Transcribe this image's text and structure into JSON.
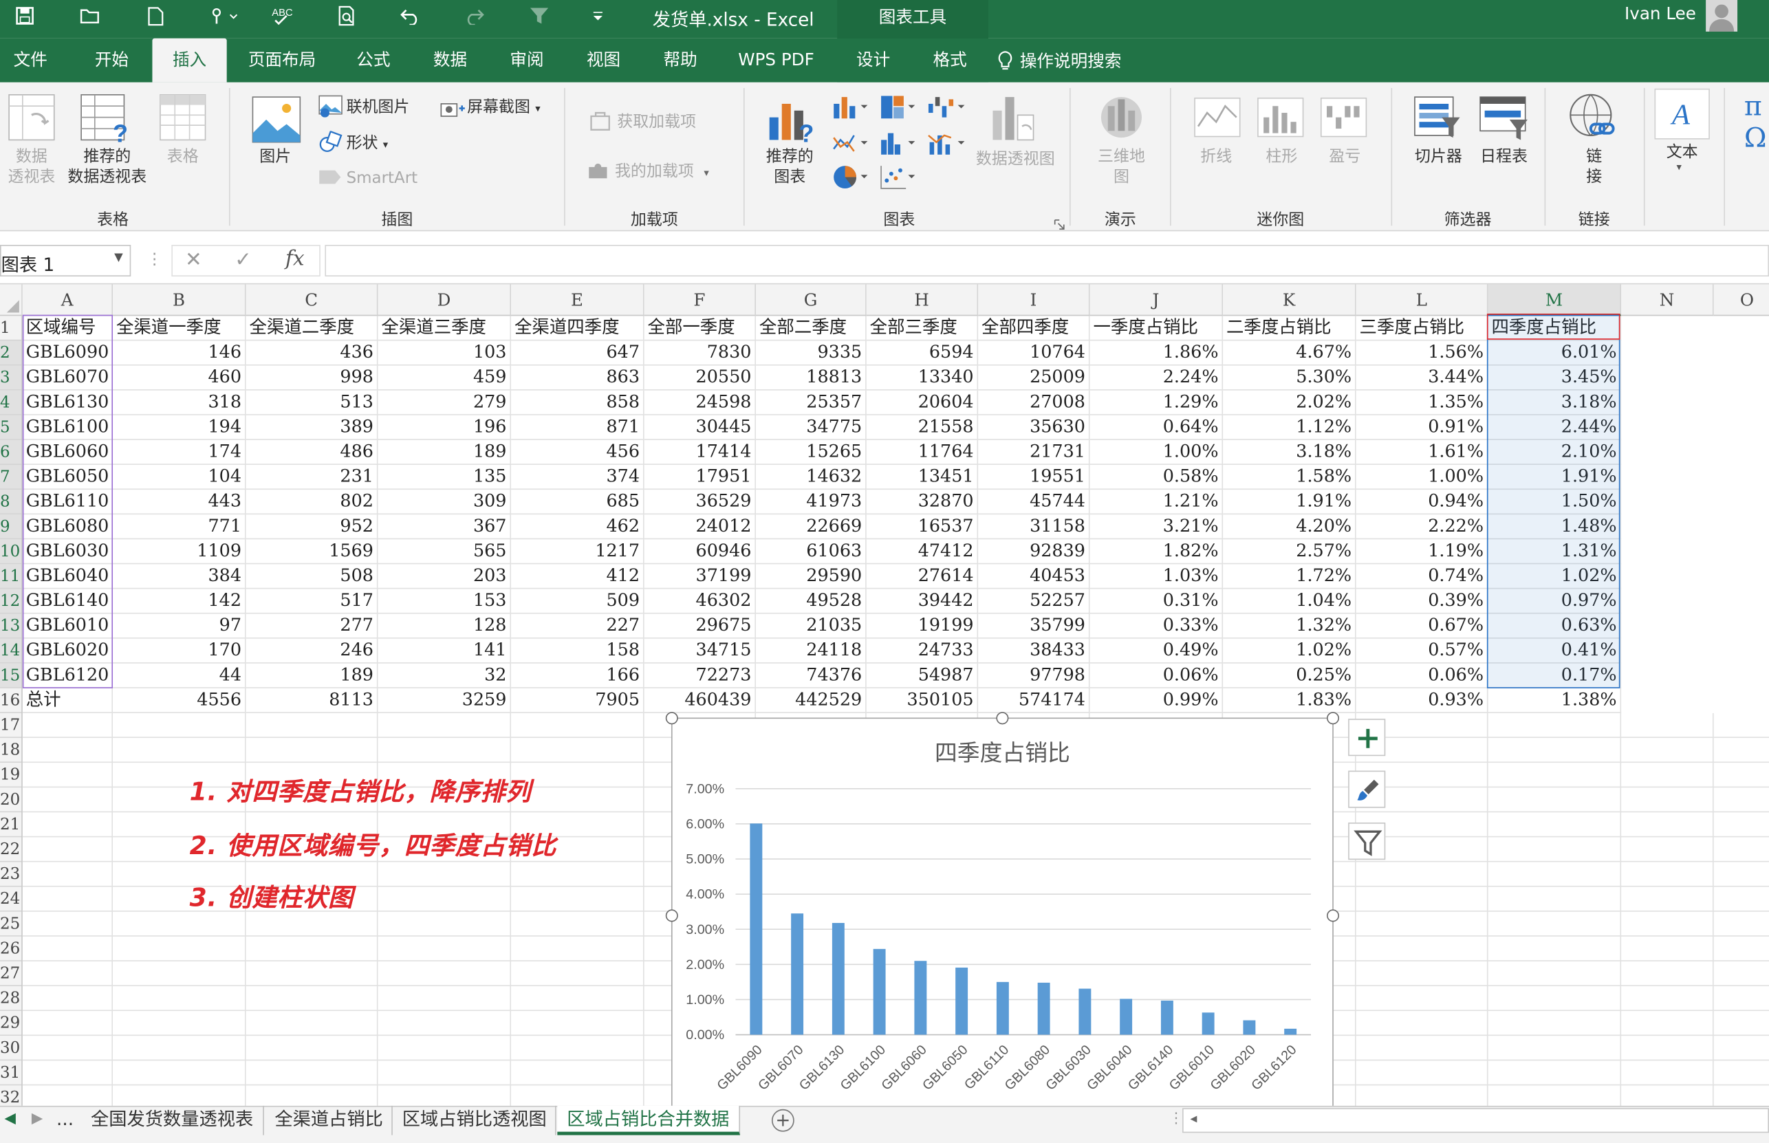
{
  "window": {
    "title": "发货单.xlsx  -  Excel",
    "context_tools": "图表工具",
    "user": "Ivan Lee",
    "accent": "#217346"
  },
  "qat_icons": [
    "save-icon",
    "open-icon",
    "new-icon",
    "touch-mode-icon",
    "spellcheck-icon",
    "print-preview-icon",
    "undo-icon",
    "redo-icon",
    "filter-icon",
    "customize-icon"
  ],
  "tabs": [
    "文件",
    "开始",
    "插入",
    "页面布局",
    "公式",
    "数据",
    "审阅",
    "视图",
    "帮助",
    "WPS PDF",
    "设计",
    "格式"
  ],
  "active_tab": "插入",
  "tell_me": "操作说明搜索",
  "ribbon": {
    "tables": {
      "group": "表格",
      "pivot": "数据\n透视表",
      "recommended_pivot": "推荐的\n数据透视表",
      "table": "表格"
    },
    "illustrations": {
      "group": "插图",
      "pictures": "图片",
      "online_pictures": "联机图片",
      "shapes": "形状",
      "smartart": "SmartArt",
      "screenshot": "屏幕截图"
    },
    "addins": {
      "group": "加载项",
      "get": "获取加载项",
      "my": "我的加载项"
    },
    "charts": {
      "group": "图表",
      "recommended": "推荐的\n图表",
      "pivot_chart": "数据透视图"
    },
    "tours": {
      "group": "演示",
      "map3d": "三维地\n图"
    },
    "sparklines": {
      "group": "迷你图",
      "line": "折线",
      "column": "柱形",
      "winloss": "盈亏"
    },
    "filters": {
      "group": "筛选器",
      "slicer": "切片器",
      "timeline": "日程表"
    },
    "links": {
      "group": "链接",
      "link": "链\n接"
    },
    "text": {
      "label": "文本"
    }
  },
  "formula_bar": {
    "name_box": "图表 1",
    "fx": "fx",
    "formula": ""
  },
  "columns": [
    "A",
    "B",
    "C",
    "D",
    "E",
    "F",
    "G",
    "H",
    "I",
    "J",
    "K",
    "L",
    "M",
    "N",
    "O"
  ],
  "rows": [
    [
      "区域编号",
      "全渠道一季度",
      "全渠道二季度",
      "全渠道三季度",
      "全渠道四季度",
      "全部一季度",
      "全部二季度",
      "全部三季度",
      "全部四季度",
      "一季度占销比",
      "二季度占销比",
      "三季度占销比",
      "四季度占销比"
    ],
    [
      "GBL6090",
      "146",
      "436",
      "103",
      "647",
      "7830",
      "9335",
      "6594",
      "10764",
      "1.86%",
      "4.67%",
      "1.56%",
      "6.01%"
    ],
    [
      "GBL6070",
      "460",
      "998",
      "459",
      "863",
      "20550",
      "18813",
      "13340",
      "25009",
      "2.24%",
      "5.30%",
      "3.44%",
      "3.45%"
    ],
    [
      "GBL6130",
      "318",
      "513",
      "279",
      "858",
      "24598",
      "25357",
      "20604",
      "27008",
      "1.29%",
      "2.02%",
      "1.35%",
      "3.18%"
    ],
    [
      "GBL6100",
      "194",
      "389",
      "196",
      "871",
      "30445",
      "34775",
      "21558",
      "35630",
      "0.64%",
      "1.12%",
      "0.91%",
      "2.44%"
    ],
    [
      "GBL6060",
      "174",
      "486",
      "189",
      "456",
      "17414",
      "15265",
      "11764",
      "21731",
      "1.00%",
      "3.18%",
      "1.61%",
      "2.10%"
    ],
    [
      "GBL6050",
      "104",
      "231",
      "135",
      "374",
      "17951",
      "14632",
      "13451",
      "19551",
      "0.58%",
      "1.58%",
      "1.00%",
      "1.91%"
    ],
    [
      "GBL6110",
      "443",
      "802",
      "309",
      "685",
      "36529",
      "41973",
      "32870",
      "45744",
      "1.21%",
      "1.91%",
      "0.94%",
      "1.50%"
    ],
    [
      "GBL6080",
      "771",
      "952",
      "367",
      "462",
      "24012",
      "22669",
      "16537",
      "31158",
      "3.21%",
      "4.20%",
      "2.22%",
      "1.48%"
    ],
    [
      "GBL6030",
      "1109",
      "1569",
      "565",
      "1217",
      "60946",
      "61063",
      "47412",
      "92839",
      "1.82%",
      "2.57%",
      "1.19%",
      "1.31%"
    ],
    [
      "GBL6040",
      "384",
      "508",
      "203",
      "412",
      "37199",
      "29590",
      "27614",
      "40453",
      "1.03%",
      "1.72%",
      "0.74%",
      "1.02%"
    ],
    [
      "GBL6140",
      "142",
      "517",
      "153",
      "509",
      "46302",
      "49528",
      "39442",
      "52257",
      "0.31%",
      "1.04%",
      "0.39%",
      "0.97%"
    ],
    [
      "GBL6010",
      "97",
      "277",
      "128",
      "227",
      "29675",
      "21035",
      "19199",
      "35799",
      "0.33%",
      "1.32%",
      "0.67%",
      "0.63%"
    ],
    [
      "GBL6020",
      "170",
      "246",
      "141",
      "158",
      "34715",
      "24118",
      "24733",
      "38433",
      "0.49%",
      "1.02%",
      "0.57%",
      "0.41%"
    ],
    [
      "GBL6120",
      "44",
      "189",
      "32",
      "166",
      "72273",
      "74376",
      "54987",
      "97798",
      "0.06%",
      "0.25%",
      "0.06%",
      "0.17%"
    ],
    [
      "总计",
      "4556",
      "8113",
      "3259",
      "7905",
      "460439",
      "442529",
      "350105",
      "574174",
      "0.99%",
      "1.83%",
      "0.93%",
      "1.38%"
    ]
  ],
  "row_numbers": [
    "1",
    "2",
    "3",
    "4",
    "5",
    "6",
    "7",
    "8",
    "9",
    "10",
    "11",
    "12",
    "13",
    "14",
    "15",
    "16",
    "17",
    "18",
    "19",
    "20",
    "21",
    "22",
    "23",
    "24",
    "25",
    "26",
    "27",
    "28",
    "29",
    "30",
    "31",
    "32"
  ],
  "notes": [
    "1. 对四季度占销比，降序排列",
    "2. 使用区域编号，四季度占销比",
    "3. 创建柱状图"
  ],
  "chart_data": {
    "type": "bar",
    "title": "四季度占销比",
    "categories": [
      "GBL6090",
      "GBL6070",
      "GBL6130",
      "GBL6100",
      "GBL6060",
      "GBL6050",
      "GBL6110",
      "GBL6080",
      "GBL6030",
      "GBL6040",
      "GBL6140",
      "GBL6010",
      "GBL6020",
      "GBL6120"
    ],
    "values": [
      6.01,
      3.45,
      3.18,
      2.44,
      2.1,
      1.91,
      1.5,
      1.48,
      1.31,
      1.02,
      0.97,
      0.63,
      0.41,
      0.17
    ],
    "ylim": [
      0,
      7
    ],
    "yticks": [
      "0.00%",
      "1.00%",
      "2.00%",
      "3.00%",
      "4.00%",
      "5.00%",
      "6.00%",
      "7.00%"
    ],
    "grid": true,
    "legend": "none",
    "bar_color": "#5b9bd5"
  },
  "sheet_tabs": [
    "全国发货数量透视表",
    "全渠道占销比",
    "区域占销比透视图",
    "区域占销比合并数据"
  ],
  "active_sheet": "区域占销比合并数据",
  "sheet_nav": "..."
}
